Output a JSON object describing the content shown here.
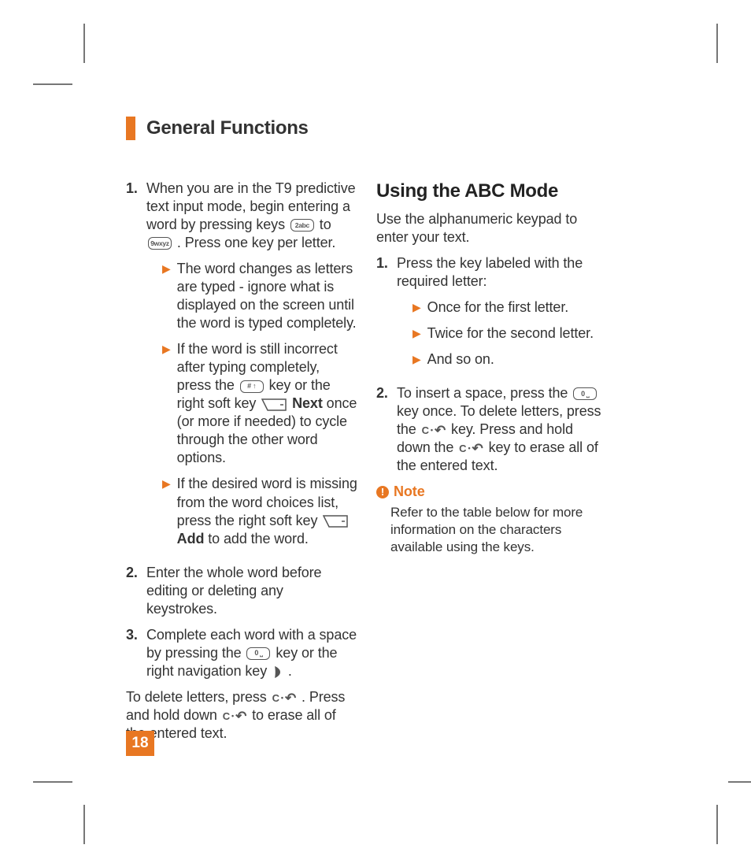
{
  "header": {
    "title": "General Functions"
  },
  "page_number": "18",
  "left": {
    "steps": [
      {
        "num": "1.",
        "text_a": "When you are in the T9 predictive text input mode, begin entering a word by pressing keys ",
        "key1": "2abc",
        "text_b": " to ",
        "key2": "9wxyz",
        "text_c": " . Press one key per letter.",
        "sub": [
          {
            "text": "The word changes as letters are typed - ignore what is displayed on the screen until the word is typed completely."
          },
          {
            "text_a": "If the word is still incorrect after typing completely, press the ",
            "key": "# ↑",
            "text_b": " key or the right soft key ",
            "soft": true,
            "bold": "Next",
            "text_c": " once (or more if needed) to cycle through the other word options."
          },
          {
            "text_a": "If the desired word is missing from the word choices list, press the right soft key ",
            "soft": true,
            "bold": "Add",
            "text_b": " to add the word."
          }
        ]
      },
      {
        "num": "2.",
        "text": "Enter the whole word before editing or deleting any keystrokes."
      },
      {
        "num": "3.",
        "text_a": "Complete each word with a space by pressing the ",
        "key": "0 ⎵",
        "text_b": " key or the right navigation key ",
        "nav": true,
        "text_c": "."
      }
    ],
    "footer_a": "To delete letters, press ",
    "footer_b": " . Press and hold down ",
    "footer_c": " to erase all of the entered text."
  },
  "right": {
    "title": "Using the ABC Mode",
    "intro": "Use the alphanumeric keypad to enter your text.",
    "steps": [
      {
        "num": "1.",
        "text": "Press the key labeled with the required letter:",
        "sub": [
          {
            "text": "Once for the first letter."
          },
          {
            "text": "Twice for the second letter."
          },
          {
            "text": "And so on."
          }
        ]
      },
      {
        "num": "2.",
        "text_a": "To insert a space, press the ",
        "key": "0 ⎵",
        "text_b": " key once. To delete letters, press the ",
        "text_c": " key. Press and hold down the ",
        "text_d": " key to erase all of the entered text."
      }
    ],
    "note_label": "Note",
    "note_body": "Refer to the table below for more information on the characters available using the keys."
  }
}
